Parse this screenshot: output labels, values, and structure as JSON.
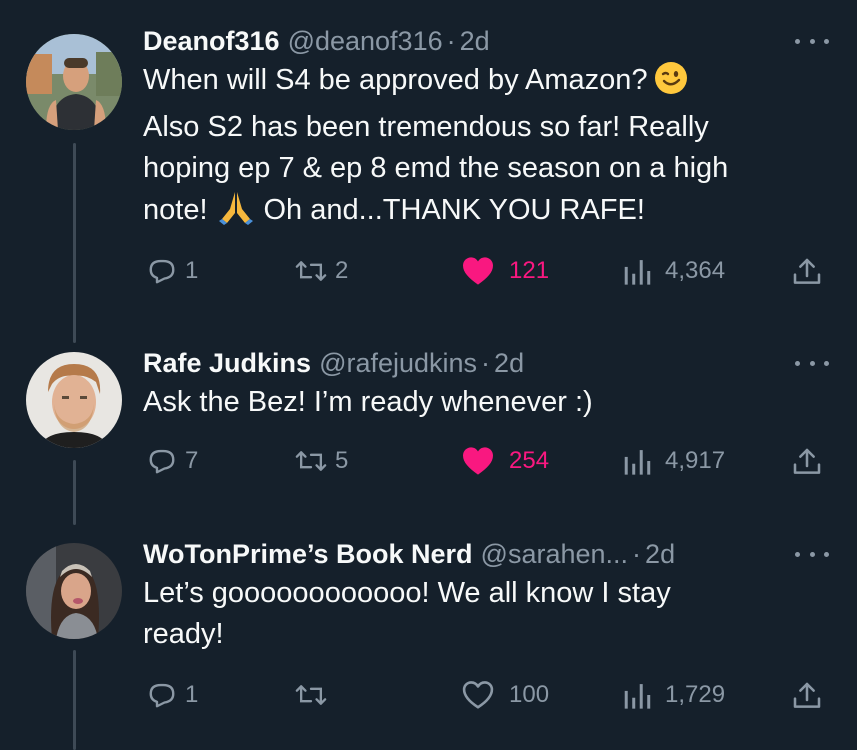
{
  "tweets": [
    {
      "name": "Deanof316",
      "handle": "@deanof316",
      "time": "2d",
      "text_line1": "When will S4 be approved by Amazon?",
      "text_line2": "Also S2 has been tremendous so far! Really",
      "text_line3": "hoping ep 7 & ep 8 emd the season on a high",
      "text_line4a": "note!",
      "text_line4b": "Oh and...THANK YOU RAFE!",
      "replies": "1",
      "retweets": "2",
      "likes": "121",
      "liked": true,
      "views": "4,364"
    },
    {
      "name": "Rafe Judkins",
      "handle": "@rafejudkins",
      "time": "2d",
      "text_line1": "Ask the Bez!  I’m ready whenever :)",
      "replies": "7",
      "retweets": "5",
      "likes": "254",
      "liked": true,
      "views": "4,917"
    },
    {
      "name": "WoTonPrime’s Book Nerd",
      "handle": "@sarahen...",
      "time": "2d",
      "text_line1": "Let’s goooooooooooo! We all know I stay",
      "text_line2": "ready!",
      "replies": "1",
      "retweets": "",
      "likes": "100",
      "liked": false,
      "views": "1,729"
    }
  ],
  "colors": {
    "background": "#15202b",
    "text": "#f7f9f9",
    "muted": "#8b98a5",
    "like": "#f91880",
    "thread_line": "#3e4a56"
  },
  "icons": [
    "reply-icon",
    "retweet-icon",
    "heart-icon",
    "views-icon",
    "share-icon",
    "more-icon",
    "wink-emoji",
    "pray-emoji"
  ]
}
